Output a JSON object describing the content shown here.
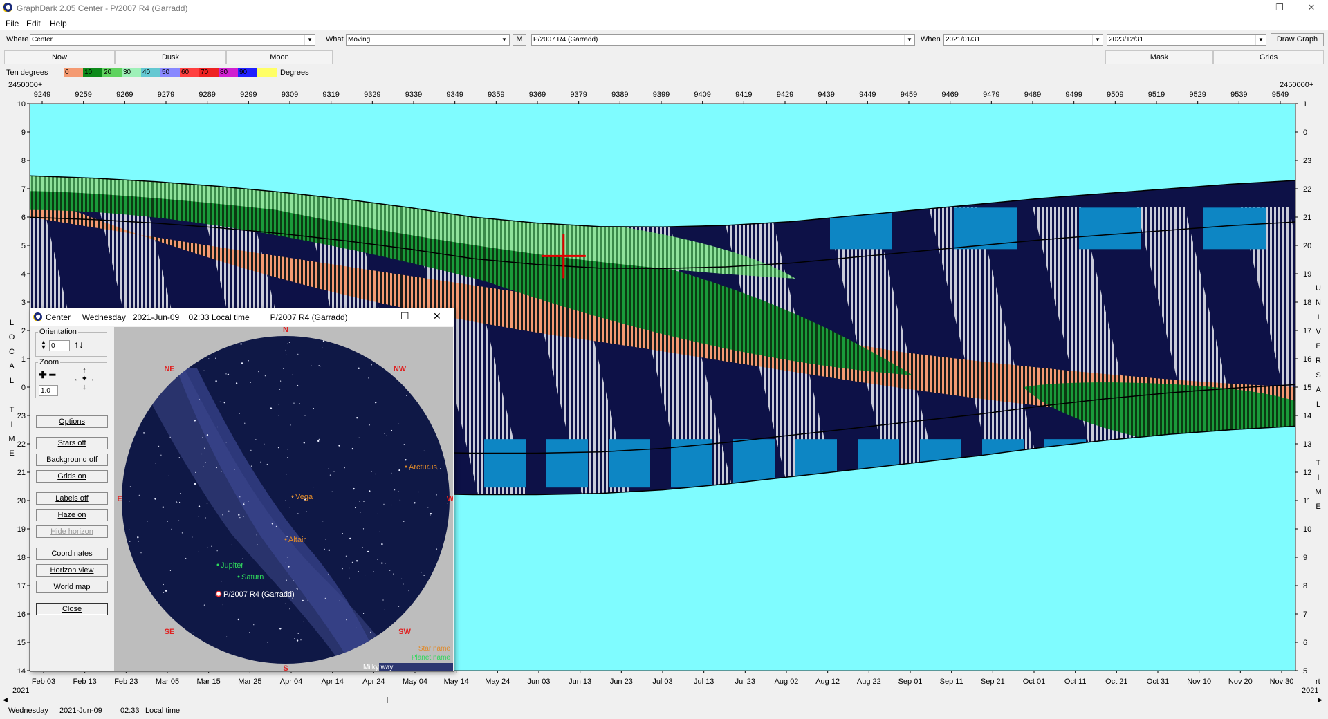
{
  "window": {
    "title": "GraphDark 2.05  Center  -  P/2007 R4 (Garradd)",
    "minimize": "—",
    "maximize": "❐",
    "close": "✕"
  },
  "menu": [
    "File",
    "Edit",
    "Help"
  ],
  "toolbar": {
    "where_label": "Where",
    "where_value": "Center",
    "what_label": "What",
    "what_value": "Moving",
    "m_button": "M",
    "object_value": "P/2007 R4 (Garradd)",
    "when_label": "When",
    "when_start": "2021/01/31",
    "when_end": "2023/12/31",
    "draw_button": "Draw Graph"
  },
  "tabs_left": [
    "Now",
    "Dusk",
    "Moon"
  ],
  "tabs_right": [
    "Mask",
    "Grids"
  ],
  "legend": {
    "label": "Ten degrees",
    "scale": [
      {
        "label": "0",
        "color": "#f49a72"
      },
      {
        "label": "10",
        "color": "#0d8a1a"
      },
      {
        "label": "20",
        "color": "#5fd35f"
      },
      {
        "label": "30",
        "color": "#9ef0b8"
      },
      {
        "label": "40",
        "color": "#64c8d2"
      },
      {
        "label": "50",
        "color": "#8888ff"
      },
      {
        "label": "60",
        "color": "#ff4040"
      },
      {
        "label": "70",
        "color": "#ee2222"
      },
      {
        "label": "80",
        "color": "#d020d0"
      },
      {
        "label": "90",
        "color": "#2020ff"
      },
      {
        "label": "",
        "color": "#ffff66"
      }
    ],
    "unit": "Degrees"
  },
  "chart_data": {
    "type": "area",
    "top_axis_prefix_left": "2450000+",
    "top_axis_prefix_right": "2450000+",
    "jd_ticks": [
      "9249",
      "9259",
      "9269",
      "9279",
      "9289",
      "9299",
      "9309",
      "9319",
      "9329",
      "9339",
      "9349",
      "9359",
      "9369",
      "9379",
      "9389",
      "9399",
      "9409",
      "9419",
      "9429",
      "9439",
      "9449",
      "9459",
      "9469",
      "9479",
      "9489",
      "9499",
      "9509",
      "9519",
      "9529",
      "9539",
      "9549"
    ],
    "date_ticks": [
      "Feb 03",
      "Feb 13",
      "Feb 23",
      "Mar 05",
      "Mar 15",
      "Mar 25",
      "Apr 04",
      "Apr 14",
      "Apr 24",
      "May 04",
      "May 14",
      "May 24",
      "Jun 03",
      "Jun 13",
      "Jun 23",
      "Jul 03",
      "Jul 13",
      "Jul 23",
      "Aug 02",
      "Aug 12",
      "Aug 22",
      "Sep 01",
      "Sep 11",
      "Sep 21",
      "Oct 01",
      "Oct 11",
      "Oct 21",
      "Oct 31",
      "Nov 10",
      "Nov 20",
      "Nov 30"
    ],
    "year_left": "2021",
    "year_right": "2021",
    "left_axis_ticks": [
      "10",
      "9",
      "8",
      "7",
      "6",
      "5",
      "4",
      "3",
      "2",
      "1",
      "0",
      "23",
      "22",
      "21",
      "20",
      "19",
      "18",
      "17",
      "16",
      "15",
      "14"
    ],
    "right_axis_ticks": [
      "1",
      "0",
      "23",
      "22",
      "21",
      "20",
      "19",
      "18",
      "17",
      "16",
      "15",
      "14",
      "13",
      "12",
      "11",
      "10",
      "9",
      "8",
      "7",
      "6",
      "5"
    ],
    "left_axis_title": [
      "L",
      "O",
      "C",
      "A",
      "L",
      "",
      "T",
      "I",
      "M",
      "E"
    ],
    "right_axis_title_top": [
      "U",
      "N",
      "I",
      "V",
      "E",
      "R",
      "S",
      "A",
      "L"
    ],
    "right_axis_title_bottom": [
      "T",
      "I",
      "M",
      "E"
    ],
    "right_corner": "rt",
    "night_top_hours": [
      6.95,
      6.85,
      6.7,
      6.5,
      6.25,
      5.95,
      5.6,
      5.2,
      4.95,
      4.8,
      4.78,
      4.85,
      5.0,
      5.25,
      5.5,
      5.75,
      6.0,
      6.2,
      6.4,
      6.6,
      6.75
    ],
    "night_bottom_hours": [
      -4.9,
      -5.2,
      -5.5,
      -5.9,
      -6.2,
      -6.4,
      -6.5,
      -6.55,
      -6.55,
      -6.5,
      -6.35,
      -6.1,
      -5.8,
      -5.5,
      -5.2,
      -4.9,
      -4.55,
      -4.25,
      -4.0,
      -3.8,
      -3.65
    ],
    "cursor": {
      "date": "2021-Jun-09",
      "hour": 3.55
    }
  },
  "popup": {
    "title": "Center     Wednesday   2021-Jun-09    02:33 Local time         P/2007 R4 (Garradd)",
    "minimize": "—",
    "maximize": "☐",
    "close": "✕",
    "orientation_label": "Orientation",
    "orientation_value": "0",
    "zoom_label": "Zoom",
    "zoom_value": "1.0",
    "buttons": [
      "Options",
      "Stars off",
      "Background off",
      "Grids on",
      "Labels off",
      "Haze on",
      "Hide horizon",
      "Coordinates",
      "Horizon view",
      "World map",
      "Close"
    ],
    "directions": {
      "n": "N",
      "ne": "NE",
      "nw": "NW",
      "e": "E",
      "w": "W",
      "se": "SE",
      "sw": "SW",
      "s": "S"
    },
    "stars": [
      "Vega",
      "Arcturus",
      "Altair"
    ],
    "planets": [
      "Jupiter",
      "Saturn"
    ],
    "target": "P/2007 R4 (Garradd)",
    "legend": [
      "Star name",
      "Planet name",
      "Milky way"
    ],
    "colors": {
      "star_label": "#e08a2a",
      "planet_label": "#2ed85a",
      "direction": "#e02020",
      "sky": "#0f1846",
      "milky": "#2c3670"
    }
  },
  "status": {
    "day": "Wednesday",
    "date": "2021-Jun-09",
    "time": "02:33",
    "time_label": "Local time"
  },
  "colors": {
    "day_sky": "#7ffcff",
    "night": "#0d1147",
    "salmon": "#f49a72",
    "moon_white": "#c9cbd8",
    "moon_blue": "#0d86c4"
  }
}
